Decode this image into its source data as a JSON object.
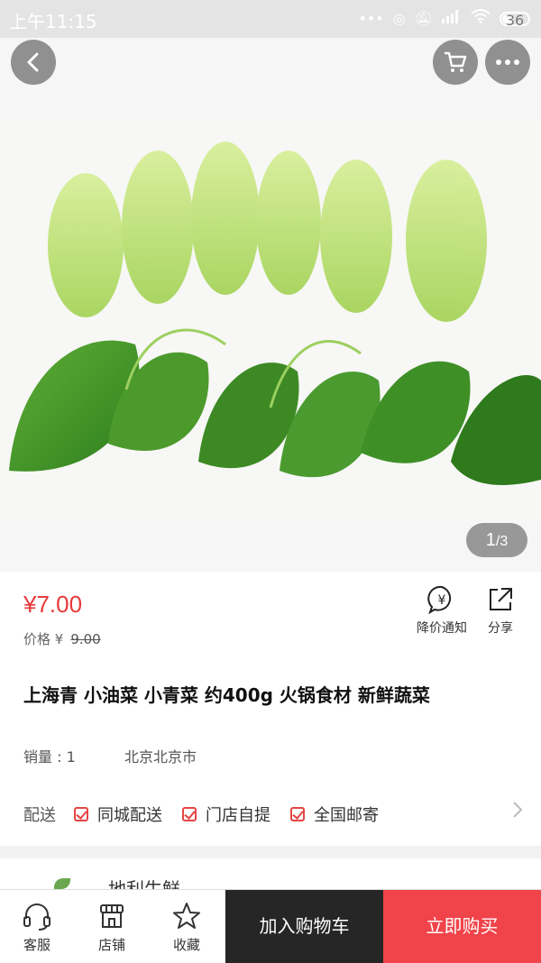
{
  "status_bar": {
    "time": "上午11:15",
    "battery": "36"
  },
  "gallery": {
    "page_current": "1",
    "page_total": "/3"
  },
  "product": {
    "price_symbol": "¥",
    "price": "7.00",
    "original_label": "价格 ¥",
    "original_price": "9.00",
    "title": "上海青 小油菜 小青菜 约400g 火锅食材 新鲜蔬菜",
    "sales": "销量 : 1",
    "location": "北京北京市"
  },
  "actions": {
    "price_alert": "降价通知",
    "share": "分享"
  },
  "delivery": {
    "label": "配送",
    "options": [
      "同城配送",
      "门店自提",
      "全国邮寄"
    ]
  },
  "shop": {
    "name": "地利生鲜"
  },
  "bottom_bar": {
    "service": "客服",
    "store": "店铺",
    "favorite": "收藏",
    "add_to_cart": "加入购物车",
    "buy_now": "立即购买"
  },
  "colors": {
    "accent": "#f0434a",
    "price": "#e83a3a",
    "dark_button": "#262626"
  }
}
